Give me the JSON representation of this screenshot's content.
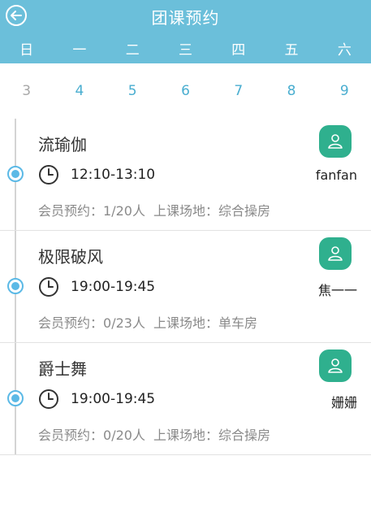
{
  "header": {
    "title": "团课预约",
    "back_icon": "back-arrow-icon"
  },
  "weekdays": [
    "日",
    "一",
    "二",
    "三",
    "四",
    "五",
    "六"
  ],
  "dates": [
    "3",
    "4",
    "5",
    "6",
    "7",
    "8",
    "9"
  ],
  "colors": {
    "header_bg": "#6bbfda",
    "date_active": "#4aaed0",
    "date_muted": "#a8a8a8",
    "timeline_dot": "#5bb9e6",
    "avatar_bg": "#2fb08e"
  },
  "courses": [
    {
      "name": "流瑜伽",
      "time": "12:10-13:10",
      "booking_label": "会员预约：",
      "booking_value": "1/20人",
      "venue_label": "上课场地：",
      "venue_value": "综合操房",
      "coach": "fanfan",
      "avatar_icon": "person-icon",
      "clock_icon": "clock-icon"
    },
    {
      "name": "极限破风",
      "time": "19:00-19:45",
      "booking_label": "会员预约：",
      "booking_value": "0/23人",
      "venue_label": "上课场地：",
      "venue_value": "单车房",
      "coach": "焦一一",
      "avatar_icon": "person-icon",
      "clock_icon": "clock-icon"
    },
    {
      "name": "爵士舞",
      "time": "19:00-19:45",
      "booking_label": "会员预约：",
      "booking_value": "0/20人",
      "venue_label": "上课场地：",
      "venue_value": "综合操房",
      "coach": "姗姗",
      "avatar_icon": "person-icon",
      "clock_icon": "clock-icon"
    }
  ]
}
